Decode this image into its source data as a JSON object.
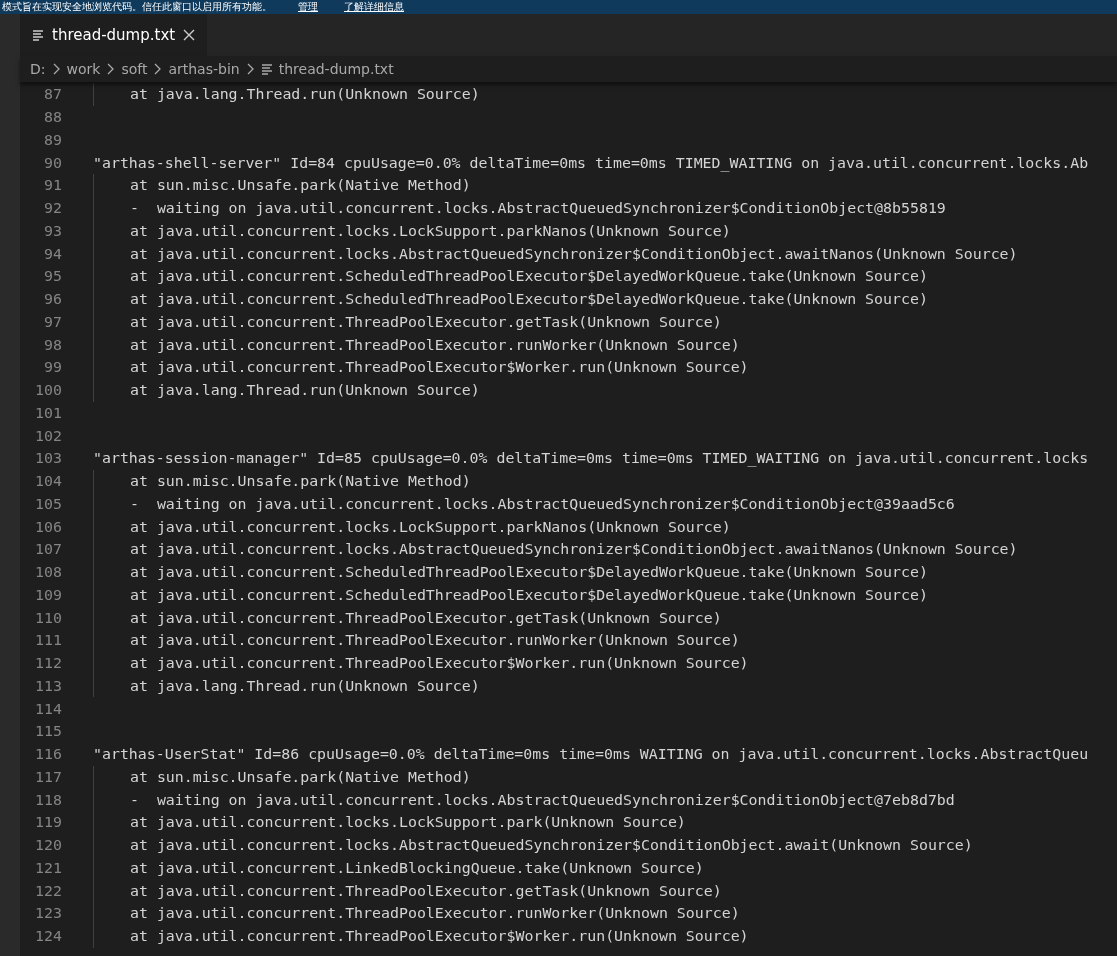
{
  "banner": {
    "message": "模式旨在实现安全地浏览代码。信任此窗口以启用所有功能。",
    "links": [
      "管理",
      "了解详细信息"
    ]
  },
  "tabs": [
    {
      "label": "thread-dump.txt",
      "selected": true
    }
  ],
  "breadcrumbs": [
    "D:",
    "work",
    "soft",
    "arthas-bin",
    "thread-dump.txt"
  ],
  "lines": [
    {
      "number": "87",
      "kind": "frame",
      "text": "at java.lang.Thread.run(Unknown Source)"
    },
    {
      "number": "88",
      "kind": "blank"
    },
    {
      "number": "89",
      "kind": "blank"
    },
    {
      "number": "90",
      "kind": "header",
      "text": "\"arthas-shell-server\" Id=84 cpuUsage=0.0% deltaTime=0ms time=0ms TIMED_WAITING on java.util.concurrent.locks.Ab"
    },
    {
      "number": "91",
      "kind": "frame",
      "text": "at sun.misc.Unsafe.park(Native Method)"
    },
    {
      "number": "92",
      "kind": "frame",
      "text": "-  waiting on java.util.concurrent.locks.AbstractQueuedSynchronizer$ConditionObject@8b55819"
    },
    {
      "number": "93",
      "kind": "frame",
      "text": "at java.util.concurrent.locks.LockSupport.parkNanos(Unknown Source)"
    },
    {
      "number": "94",
      "kind": "frame",
      "text": "at java.util.concurrent.locks.AbstractQueuedSynchronizer$ConditionObject.awaitNanos(Unknown Source)"
    },
    {
      "number": "95",
      "kind": "frame",
      "text": "at java.util.concurrent.ScheduledThreadPoolExecutor$DelayedWorkQueue.take(Unknown Source)"
    },
    {
      "number": "96",
      "kind": "frame",
      "text": "at java.util.concurrent.ScheduledThreadPoolExecutor$DelayedWorkQueue.take(Unknown Source)"
    },
    {
      "number": "97",
      "kind": "frame",
      "text": "at java.util.concurrent.ThreadPoolExecutor.getTask(Unknown Source)"
    },
    {
      "number": "98",
      "kind": "frame",
      "text": "at java.util.concurrent.ThreadPoolExecutor.runWorker(Unknown Source)"
    },
    {
      "number": "99",
      "kind": "frame",
      "text": "at java.util.concurrent.ThreadPoolExecutor$Worker.run(Unknown Source)"
    },
    {
      "number": "100",
      "kind": "frame",
      "text": "at java.lang.Thread.run(Unknown Source)"
    },
    {
      "number": "101",
      "kind": "blank"
    },
    {
      "number": "102",
      "kind": "blank"
    },
    {
      "number": "103",
      "kind": "header",
      "text": "\"arthas-session-manager\" Id=85 cpuUsage=0.0% deltaTime=0ms time=0ms TIMED_WAITING on java.util.concurrent.locks"
    },
    {
      "number": "104",
      "kind": "frame",
      "text": "at sun.misc.Unsafe.park(Native Method)"
    },
    {
      "number": "105",
      "kind": "frame",
      "text": "-  waiting on java.util.concurrent.locks.AbstractQueuedSynchronizer$ConditionObject@39aad5c6"
    },
    {
      "number": "106",
      "kind": "frame",
      "text": "at java.util.concurrent.locks.LockSupport.parkNanos(Unknown Source)"
    },
    {
      "number": "107",
      "kind": "frame",
      "text": "at java.util.concurrent.locks.AbstractQueuedSynchronizer$ConditionObject.awaitNanos(Unknown Source)"
    },
    {
      "number": "108",
      "kind": "frame",
      "text": "at java.util.concurrent.ScheduledThreadPoolExecutor$DelayedWorkQueue.take(Unknown Source)"
    },
    {
      "number": "109",
      "kind": "frame",
      "text": "at java.util.concurrent.ScheduledThreadPoolExecutor$DelayedWorkQueue.take(Unknown Source)"
    },
    {
      "number": "110",
      "kind": "frame",
      "text": "at java.util.concurrent.ThreadPoolExecutor.getTask(Unknown Source)"
    },
    {
      "number": "111",
      "kind": "frame",
      "text": "at java.util.concurrent.ThreadPoolExecutor.runWorker(Unknown Source)"
    },
    {
      "number": "112",
      "kind": "frame",
      "text": "at java.util.concurrent.ThreadPoolExecutor$Worker.run(Unknown Source)"
    },
    {
      "number": "113",
      "kind": "frame",
      "text": "at java.lang.Thread.run(Unknown Source)"
    },
    {
      "number": "114",
      "kind": "blank"
    },
    {
      "number": "115",
      "kind": "blank"
    },
    {
      "number": "116",
      "kind": "header",
      "text": "\"arthas-UserStat\" Id=86 cpuUsage=0.0% deltaTime=0ms time=0ms WAITING on java.util.concurrent.locks.AbstractQueu"
    },
    {
      "number": "117",
      "kind": "frame",
      "text": "at sun.misc.Unsafe.park(Native Method)"
    },
    {
      "number": "118",
      "kind": "frame",
      "text": "-  waiting on java.util.concurrent.locks.AbstractQueuedSynchronizer$ConditionObject@7eb8d7bd"
    },
    {
      "number": "119",
      "kind": "frame",
      "text": "at java.util.concurrent.locks.LockSupport.park(Unknown Source)"
    },
    {
      "number": "120",
      "kind": "frame",
      "text": "at java.util.concurrent.locks.AbstractQueuedSynchronizer$ConditionObject.await(Unknown Source)"
    },
    {
      "number": "121",
      "kind": "frame",
      "text": "at java.util.concurrent.LinkedBlockingQueue.take(Unknown Source)"
    },
    {
      "number": "122",
      "kind": "frame",
      "text": "at java.util.concurrent.ThreadPoolExecutor.getTask(Unknown Source)"
    },
    {
      "number": "123",
      "kind": "frame",
      "text": "at java.util.concurrent.ThreadPoolExecutor.runWorker(Unknown Source)"
    },
    {
      "number": "124",
      "kind": "frame",
      "text": "at java.util.concurrent.ThreadPoolExecutor$Worker.run(Unknown Source)"
    }
  ]
}
